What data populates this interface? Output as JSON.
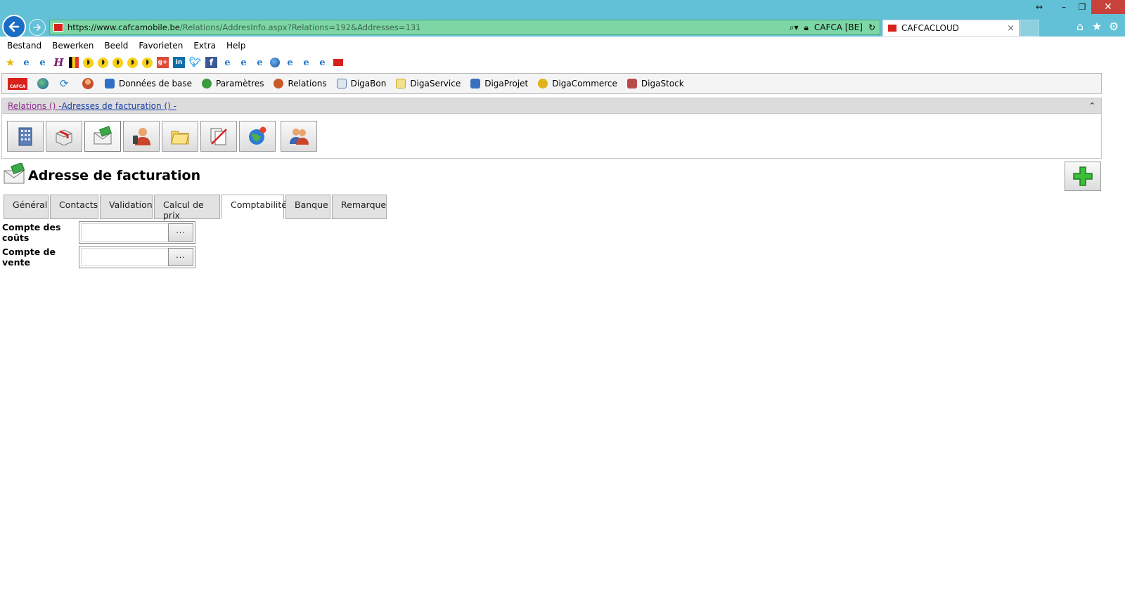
{
  "browser": {
    "url_host": "https://www.cafcamobile.be",
    "url_path": "/Relations/AddresInfo.aspx?Relations=192&Addresses=131",
    "site_identity": "CAFCA [BE]",
    "tab_title": "CAFCACLOUD",
    "tab_close": "×",
    "window_controls": {
      "resize": "↔",
      "minimize": "–",
      "restore": "❐",
      "close": "✕"
    },
    "icons": [
      "home-icon",
      "star-icon",
      "gear-icon"
    ]
  },
  "menu": [
    "Bestand",
    "Bewerken",
    "Beeld",
    "Favorieten",
    "Extra",
    "Help"
  ],
  "favorites_bar": [
    "star-icon",
    "ie-icon",
    "ie-icon",
    "h-icon",
    "flag-icon",
    "bee-icon",
    "bee-icon",
    "bee-icon",
    "bee-icon",
    "bee-icon",
    "google-plus-icon",
    "linkedin-icon",
    "twitter-icon",
    "facebook-icon",
    "ie-icon",
    "ie-icon",
    "ie-icon",
    "globe-icon",
    "ie-icon",
    "ie-icon",
    "ie-icon",
    "cafca-icon"
  ],
  "app_toolbar": {
    "logo_text": "CAFCA",
    "items": [
      {
        "label": "Données de base",
        "color": "#2f6fc8"
      },
      {
        "label": "Paramètres",
        "color": "#3b9a3b"
      },
      {
        "label": "Relations",
        "color": "#c85a2a"
      },
      {
        "label": "DigaBon",
        "color": "#5a7fa8"
      },
      {
        "label": "DigaService",
        "color": "#e8c53a"
      },
      {
        "label": "DigaProjet",
        "color": "#3b6fbf"
      },
      {
        "label": "DigaCommerce",
        "color": "#e2b21b"
      },
      {
        "label": "DigaStock",
        "color": "#b84a4a"
      }
    ]
  },
  "breadcrumb": {
    "part1": "Relations () - ",
    "part2": "Adresses de facturation () -",
    "collapse": "⌃"
  },
  "page": {
    "title": "Adresse de facturation",
    "add_button": "+"
  },
  "tabs": [
    {
      "label": "Général",
      "active": false
    },
    {
      "label": "Contacts",
      "active": false
    },
    {
      "label": "Validation",
      "active": false
    },
    {
      "label": "Calcul de prix",
      "active": false
    },
    {
      "label": "Comptabilité",
      "active": true
    },
    {
      "label": "Banque",
      "active": false
    },
    {
      "label": "Remarque",
      "active": false
    }
  ],
  "form": {
    "cost_account": {
      "label": "Compte des coûts",
      "value": "",
      "button": "···"
    },
    "sales_account": {
      "label": "Compte de vente",
      "value": "",
      "button": "···"
    }
  }
}
